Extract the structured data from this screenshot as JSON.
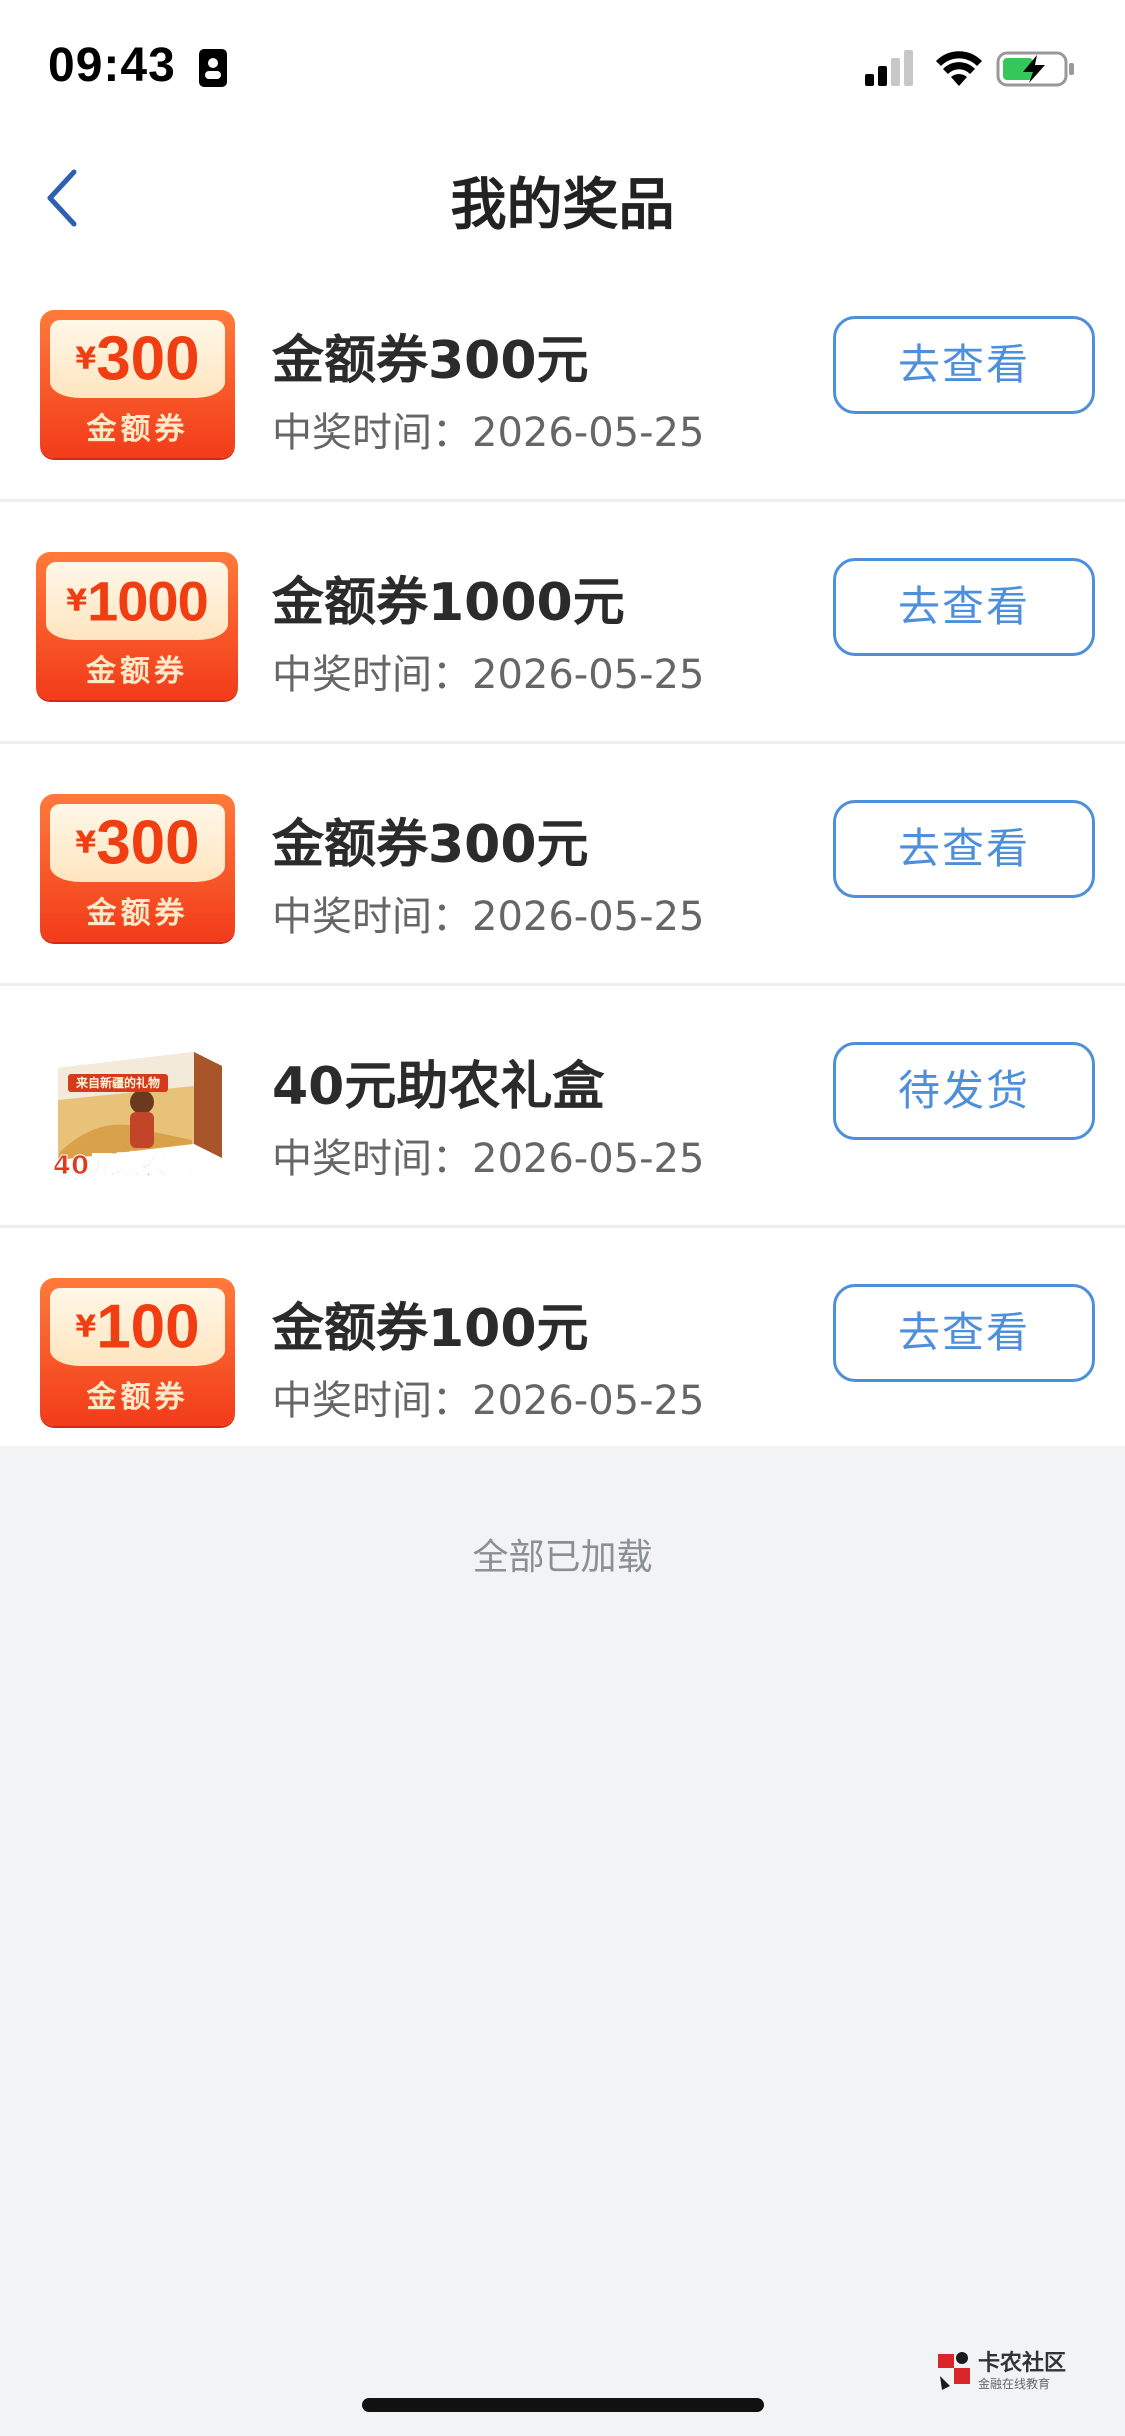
{
  "status_bar": {
    "time": "09:43"
  },
  "nav": {
    "title": "我的奖品"
  },
  "prizes": [
    {
      "badge_amount": "300",
      "badge_currency": "¥",
      "badge_label": "金额券",
      "name": "金额券300元",
      "date": "中奖时间：2026-05-25",
      "action": "去查看"
    },
    {
      "badge_amount": "1000",
      "badge_currency": "¥",
      "badge_label": "金额券",
      "name": "金额券1000元",
      "date": "中奖时间：2026-05-25",
      "action": "去查看"
    },
    {
      "badge_amount": "300",
      "badge_currency": "¥",
      "badge_label": "金额券",
      "name": "金额券300元",
      "date": "中奖时间：2026-05-25",
      "action": "去查看"
    },
    {
      "gift_title": "来自新疆的礼物",
      "gift_caption": "40元助农礼盒",
      "name": "40元助农礼盒",
      "date": "中奖时间：2026-05-25",
      "action": "待发货"
    },
    {
      "badge_amount": "100",
      "badge_currency": "¥",
      "badge_label": "金额券",
      "name": "金额券100元",
      "date": "中奖时间：2026-05-25",
      "action": "去查看"
    }
  ],
  "footer": {
    "loaded_text": "全部已加载"
  },
  "watermark": {
    "title": "卡农社区",
    "subtitle": "金融在线教育"
  },
  "colors": {
    "accent": "#4e8fdc",
    "coupon_red": "#f23b1a",
    "page_bg": "#f2f3f5"
  }
}
